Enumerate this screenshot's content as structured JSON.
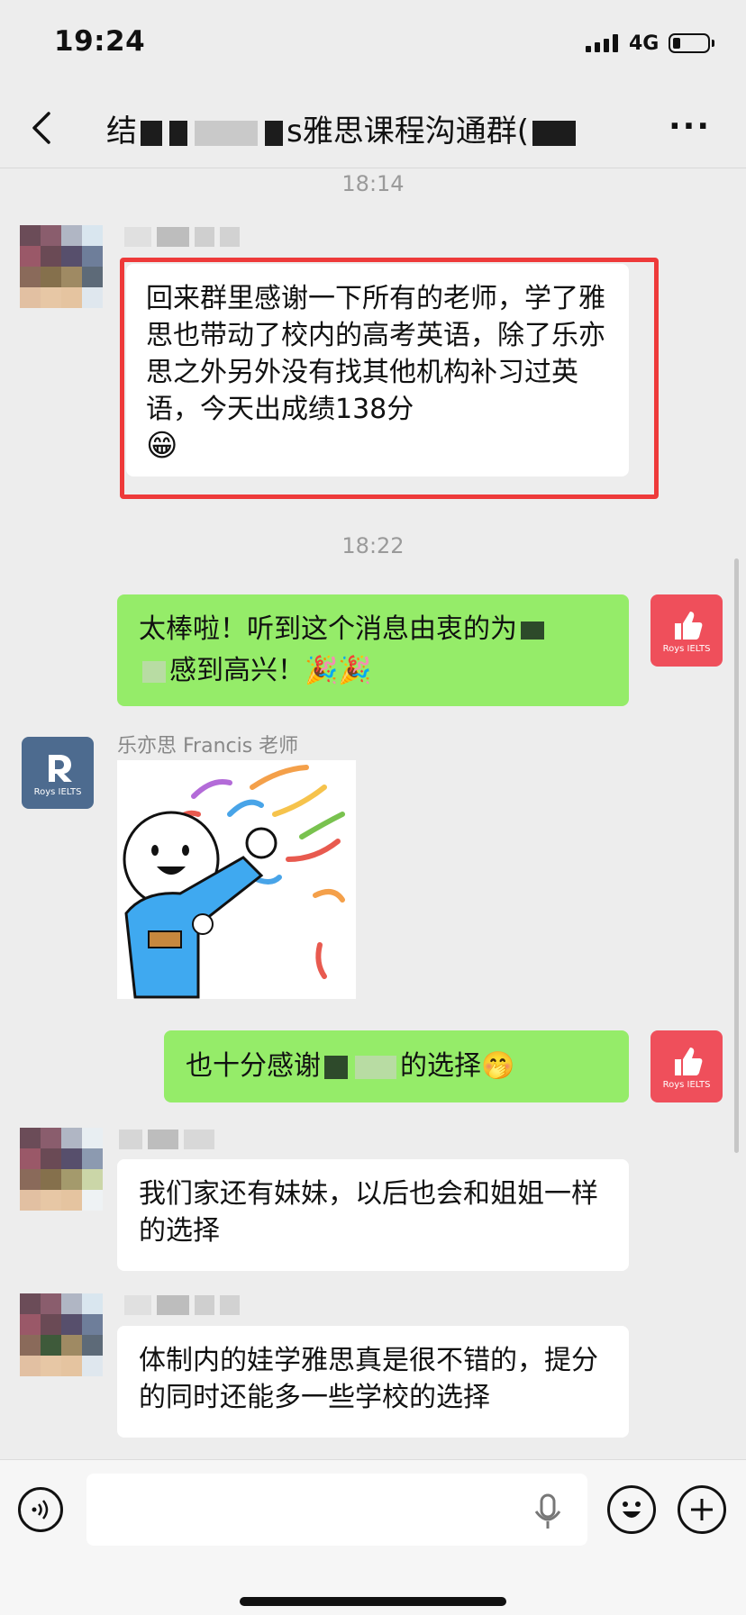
{
  "status_bar": {
    "time": "19:24",
    "network": "4G"
  },
  "header": {
    "title_visible_prefix": "结",
    "title_visible_middle": "s雅思课程沟通群(",
    "more_label": "···"
  },
  "messages": {
    "ts1": "18:14",
    "msg1": {
      "text": "回来群里感谢一下所有的老师，学了雅思也带动了校内的高考英语，除了乐亦思之外另外没有找其他机构补习过英语，今天出成绩138分",
      "emoji": "😁"
    },
    "ts2": "18:22",
    "msg2": {
      "text_a": "太棒啦！听到这个消息由衷的为",
      "text_b": "感到高兴！",
      "emoji": "🎉🎉"
    },
    "msg3": {
      "sender": "乐亦思 Francis 老师"
    },
    "msg4": {
      "text_a": "也十分感谢",
      "text_b": "的选择",
      "emoji": "🤭"
    },
    "msg5": {
      "text": "我们家还有妹妹，以后也会和姐姐一样的选择"
    },
    "msg6": {
      "text": "体制内的娃学雅思真是很不错的，提分的同时还能多一些学校的选择"
    }
  },
  "avatars": {
    "brand": "Roys IELTS"
  },
  "colors": {
    "green_bubble": "#95ec69",
    "highlight": "#ee3a3a",
    "brand_red": "#ef4f5b",
    "brand_blue": "#4d6b8f"
  },
  "icons": [
    "back-icon",
    "more-icon",
    "voice-icon",
    "microphone-icon",
    "emoji-icon",
    "plus-icon",
    "thumbs-up-icon"
  ]
}
